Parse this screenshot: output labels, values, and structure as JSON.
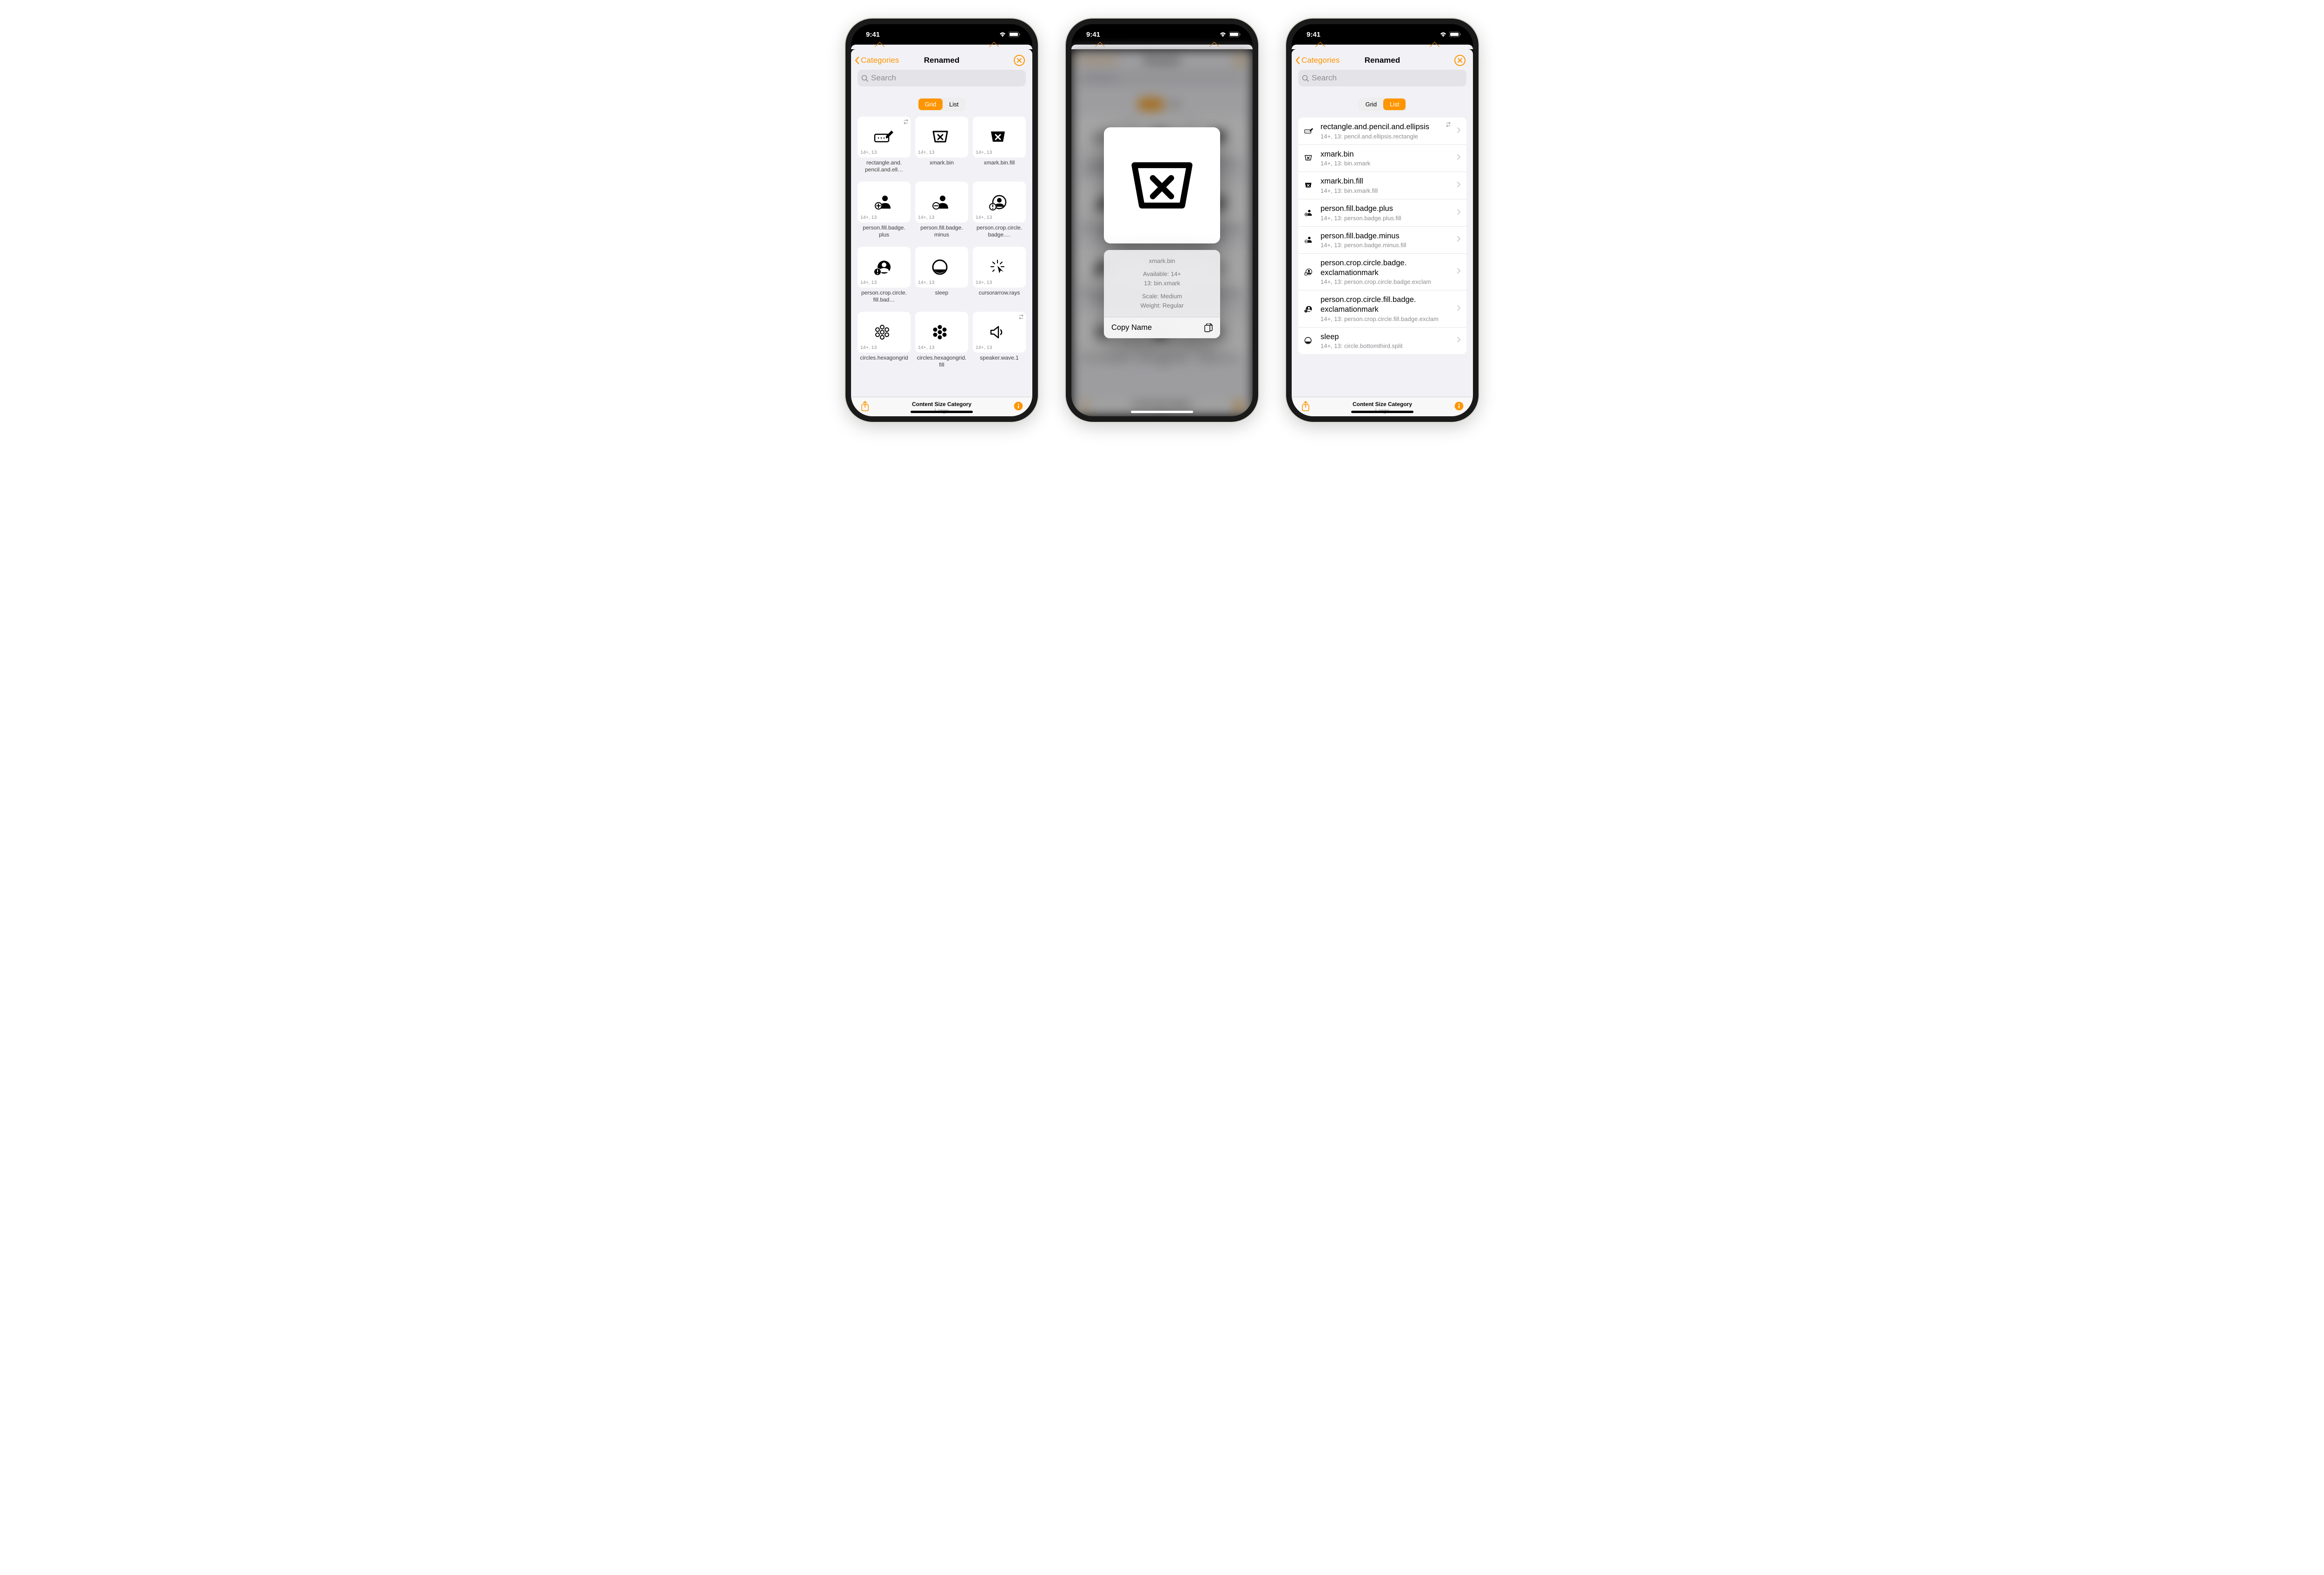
{
  "status": {
    "time": "9:41"
  },
  "nav": {
    "back": "Categories",
    "title": "Renamed"
  },
  "search": {
    "placeholder": "Search"
  },
  "segments": {
    "grid": "Grid",
    "list": "List"
  },
  "badge": "14+, 13",
  "gridItems": [
    {
      "label": "rectangle.and.pencil.and.ell…",
      "swap": true
    },
    {
      "label": "xmark.bin"
    },
    {
      "label": "xmark.bin.fill"
    },
    {
      "label": "person.fill.badge.plus"
    },
    {
      "label": "person.fill.badge.minus"
    },
    {
      "label": "person.crop.circle.badge.…"
    },
    {
      "label": "person.crop.circle.fill.bad…"
    },
    {
      "label": "sleep"
    },
    {
      "label": "cursorarrow.rays"
    },
    {
      "label": "circles.hexagongrid"
    },
    {
      "label": "circles.hexagongrid.fill"
    },
    {
      "label": "speaker.wave.1",
      "swap": true
    }
  ],
  "listItems": [
    {
      "name": "rectangle.and.pencil.and.ellipsis",
      "sub": "14+, 13: pencil.and.ellipsis.rectangle",
      "swap": true
    },
    {
      "name": "xmark.bin",
      "sub": "14+, 13: bin.xmark"
    },
    {
      "name": "xmark.bin.fill",
      "sub": "14+, 13: bin.xmark.fill"
    },
    {
      "name": "person.fill.badge.plus",
      "sub": "14+, 13: person.badge.plus.fill"
    },
    {
      "name": "person.fill.badge.minus",
      "sub": "14+, 13: person.badge.minus.fill"
    },
    {
      "name": "person.crop.circle.badge.exclamationmark",
      "sub": "14+, 13: person.crop.circle.badge.exclam"
    },
    {
      "name": "person.crop.circle.fill.badge.exclamationmark",
      "sub": "14+, 13: person.crop.circle.fill.badge.exclam"
    },
    {
      "name": "sleep",
      "sub": "14+, 13: circle.bottomthird.split"
    }
  ],
  "context": {
    "name": "xmark.bin",
    "available": "Available: 14+",
    "legacy": "13: bin.xmark",
    "scale": "Scale: Medium",
    "weight": "Weight: Regular",
    "copy": "Copy Name"
  },
  "toolbar": {
    "label": "Content Size Category",
    "value": "Large"
  }
}
